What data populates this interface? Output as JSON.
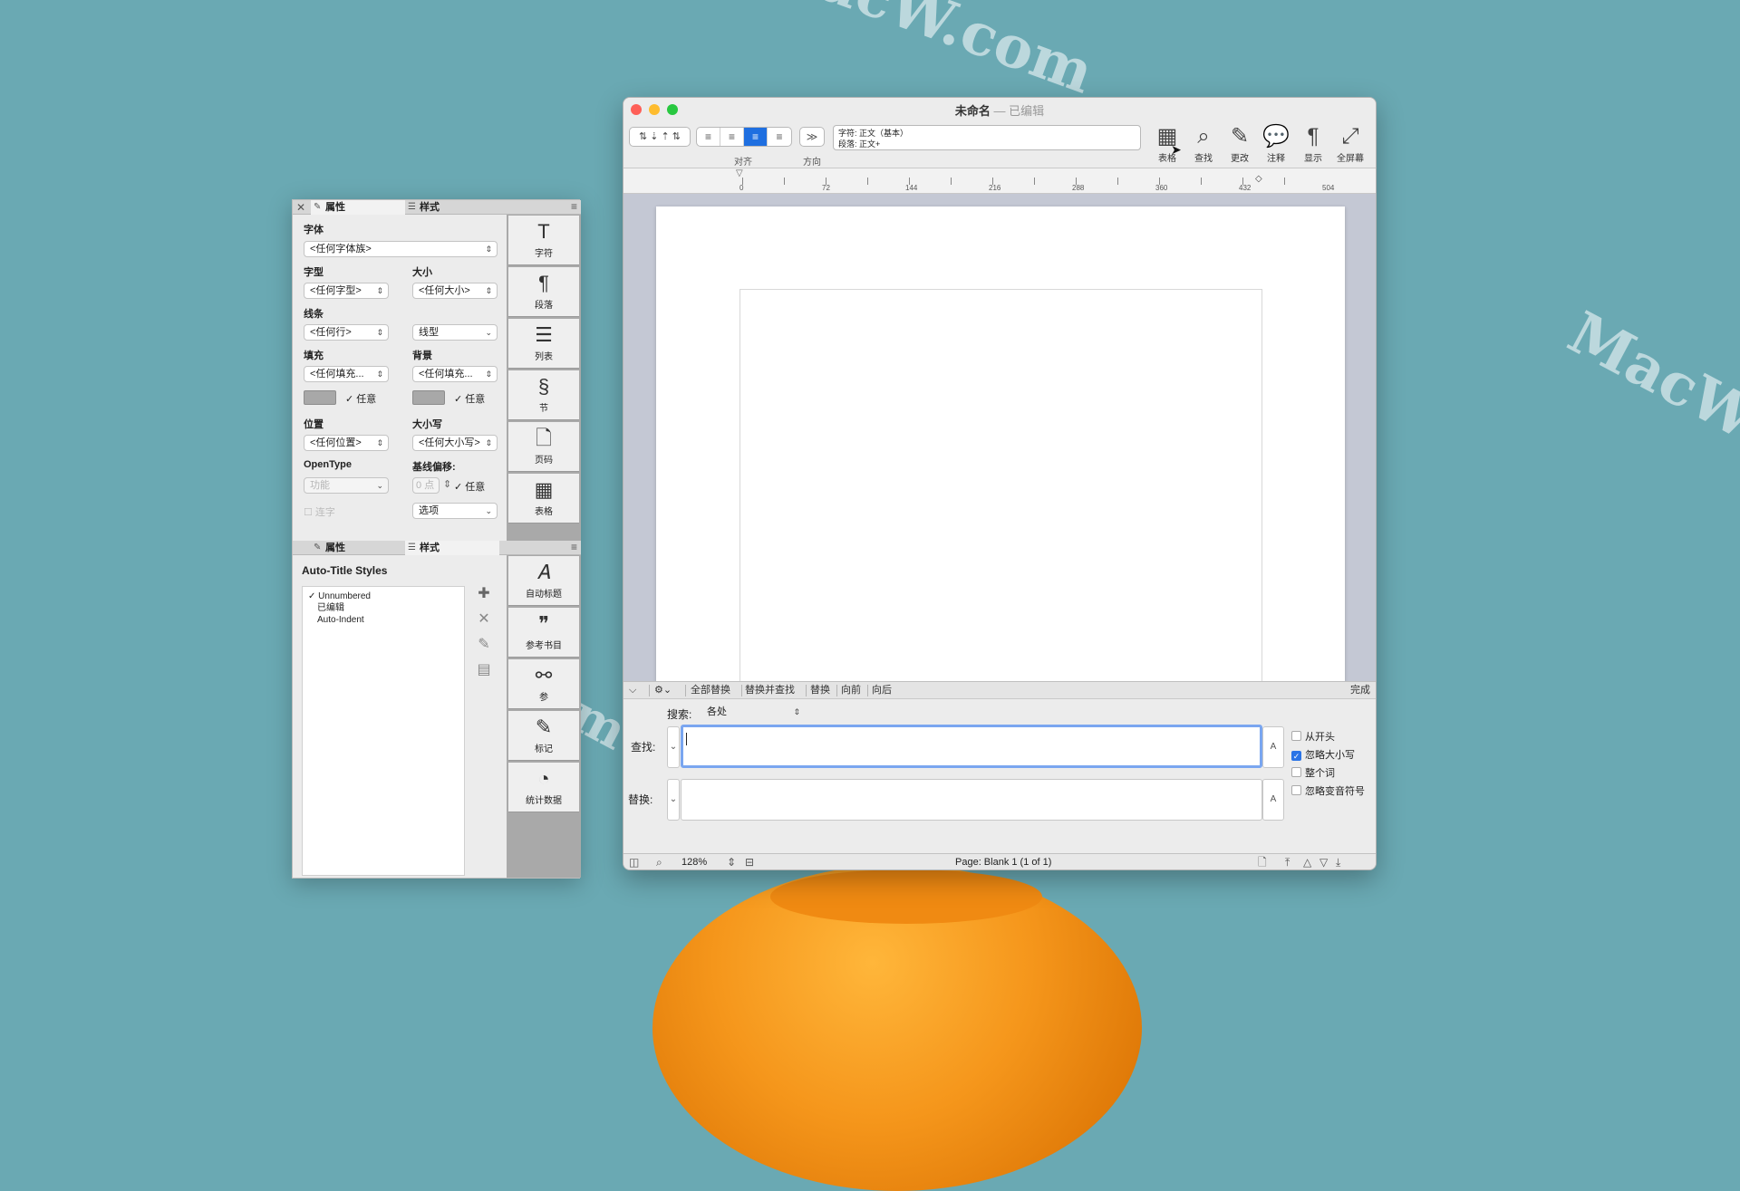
{
  "inspector": {
    "top_tabs": [
      "属性",
      "样式"
    ],
    "sections": {
      "font_label": "字体",
      "font_value": "<任何字体族>",
      "typeface_label": "字型",
      "typeface_value": "<任何字型>",
      "size_label": "大小",
      "size_value": "<任何大小>",
      "lines_label": "线条",
      "lines_value": "<任何行>",
      "linetype_value": "线型",
      "fill_label": "填充",
      "fill_value": "<任何填充...",
      "bg_label": "背景",
      "bg_value": "<任何填充...",
      "any_label": "任意",
      "position_label": "位置",
      "position_value": "<任何位置>",
      "case_label": "大小写",
      "case_value": "<任何大小写>",
      "opentype_label": "OpenType",
      "opentype_value": "功能",
      "baseline_label": "基线偏移:",
      "baseline_value": "0 点",
      "ligature_label": "连字",
      "options_value": "选项"
    },
    "side_buttons": [
      "字符",
      "段落",
      "列表",
      "节",
      "页码",
      "表格"
    ],
    "bottom_tabs": [
      "属性",
      "样式"
    ],
    "auto_title": "Auto-Title Styles",
    "style_items": [
      "Unnumbered",
      "已编辑",
      "Auto-Indent"
    ],
    "bottom_buttons": [
      "自动标题",
      "参考书目",
      "参",
      "标记",
      "统计数据"
    ]
  },
  "window": {
    "title": "未命名",
    "edited": "— 已编辑",
    "style_line1": "字符: 正文（基本）",
    "style_line2": "段落: 正文+",
    "align_label": "对齐",
    "direction_label": "方向",
    "tools": [
      "表格",
      "查找",
      "更改",
      "注释",
      "显示",
      "全屏幕"
    ],
    "ruler_numbers": [
      "0",
      "72",
      "144",
      "216",
      "288",
      "360",
      "432",
      "504"
    ]
  },
  "findbar": {
    "items": [
      "全部替换",
      "替换并查找",
      "替换",
      "向前",
      "向后"
    ],
    "done": "完成"
  },
  "findpanel": {
    "search_label": "搜索:",
    "search_scope": "各处",
    "find_label": "查找:",
    "find_value": "",
    "replace_label": "替换:",
    "replace_value": "",
    "options": [
      {
        "label": "从开头",
        "checked": false
      },
      {
        "label": "忽略大小写",
        "checked": true
      },
      {
        "label": "整个词",
        "checked": false
      },
      {
        "label": "忽略变音符号",
        "checked": false
      }
    ]
  },
  "statusbar": {
    "zoom": "128%",
    "page": "Page: Blank 1 (1 of 1)"
  },
  "colors": {
    "desktop": "#6aa9b3",
    "accent": "#1f6fe0"
  }
}
